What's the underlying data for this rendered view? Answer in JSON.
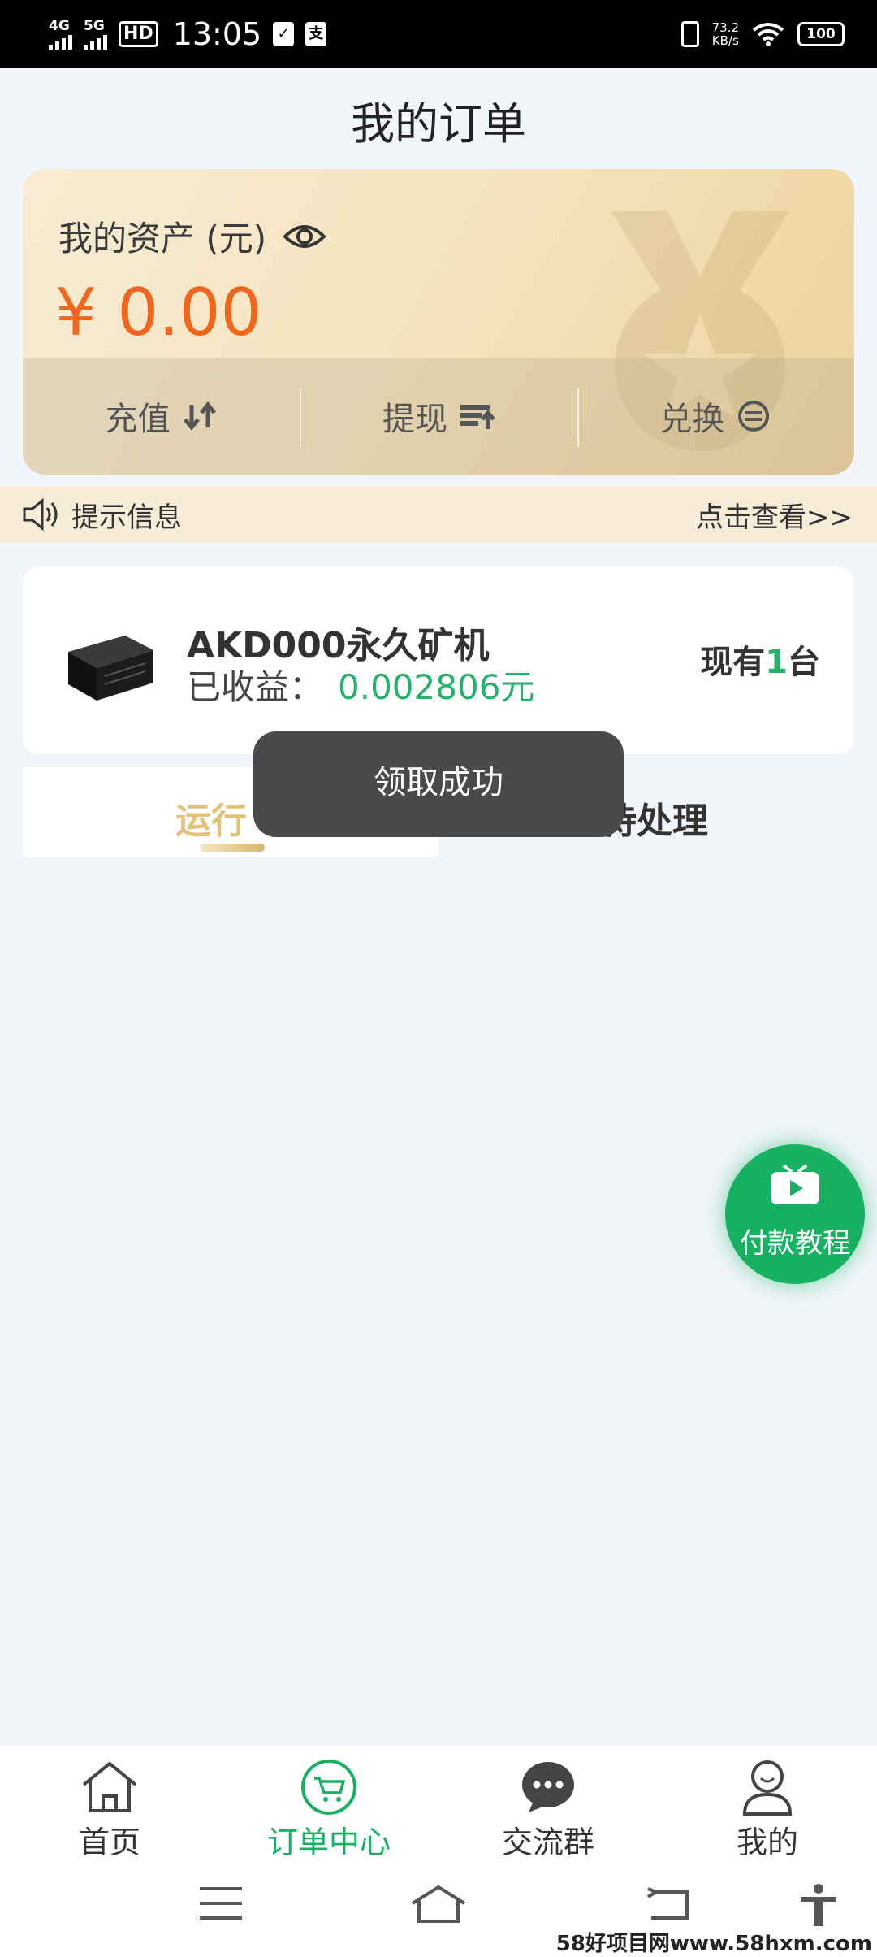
{
  "status_bar": {
    "sim1": "4G",
    "sim2": "5G",
    "hd": "HD",
    "time": "13:05",
    "speed_value": "73.2",
    "speed_unit": "KB/s",
    "battery": "100"
  },
  "header": {
    "title": "我的订单"
  },
  "assets": {
    "label": "我的资产 (元)",
    "value": "¥ 0.00",
    "actions": {
      "recharge": "充值",
      "withdraw": "提现",
      "exchange": "兑换"
    }
  },
  "notice": {
    "label": "提示信息",
    "link": "点击查看>>"
  },
  "product": {
    "name": "AKD000永久矿机",
    "earn_label": "已收益：",
    "earn_value": "0.002806元",
    "owned_prefix": "现有",
    "owned_count": "1",
    "owned_suffix": "台"
  },
  "tabs": {
    "running": "运行",
    "pending": "待处理"
  },
  "toast": {
    "message": "领取成功"
  },
  "fab": {
    "label": "付款教程"
  },
  "bottom_nav": {
    "home": "首页",
    "orders": "订单中心",
    "group": "交流群",
    "mine": "我的"
  },
  "watermark": "58好项目网www.58hxm.com",
  "colors": {
    "accent_green": "#17b161",
    "asset_orange": "#f2651e",
    "tab_gold": "#e2c27a"
  }
}
